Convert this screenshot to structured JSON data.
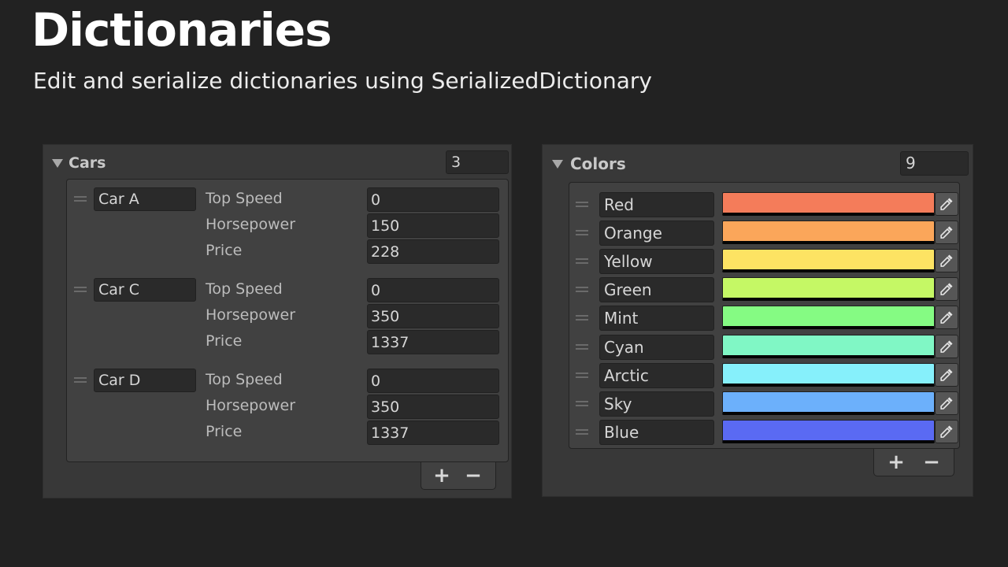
{
  "header": {
    "title": "Dictionaries",
    "subtitle": "Edit and serialize dictionaries using SerializedDictionary"
  },
  "cars": {
    "label": "Cars",
    "count": "3",
    "entries": [
      {
        "key": "Car A",
        "fields": [
          {
            "label": "Top Speed",
            "value": "0"
          },
          {
            "label": "Horsepower",
            "value": "150"
          },
          {
            "label": "Price",
            "value": "228"
          }
        ]
      },
      {
        "key": "Car C",
        "fields": [
          {
            "label": "Top Speed",
            "value": "0"
          },
          {
            "label": "Horsepower",
            "value": "350"
          },
          {
            "label": "Price",
            "value": "1337"
          }
        ]
      },
      {
        "key": "Car D",
        "fields": [
          {
            "label": "Top Speed",
            "value": "0"
          },
          {
            "label": "Horsepower",
            "value": "350"
          },
          {
            "label": "Price",
            "value": "1337"
          }
        ]
      }
    ],
    "add_label": "+",
    "remove_label": "−"
  },
  "colors": {
    "label": "Colors",
    "count": "9",
    "entries": [
      {
        "key": "Red",
        "color": "#f47c5a"
      },
      {
        "key": "Orange",
        "color": "#fba65a"
      },
      {
        "key": "Yellow",
        "color": "#fde363"
      },
      {
        "key": "Green",
        "color": "#c5f865"
      },
      {
        "key": "Mint",
        "color": "#85fb83"
      },
      {
        "key": "Cyan",
        "color": "#80f7c5"
      },
      {
        "key": "Arctic",
        "color": "#86f0fb"
      },
      {
        "key": "Sky",
        "color": "#6cb0fb"
      },
      {
        "key": "Blue",
        "color": "#5a6af3"
      }
    ],
    "add_label": "+",
    "remove_label": "−",
    "picker_icon": "eyedropper-icon"
  }
}
